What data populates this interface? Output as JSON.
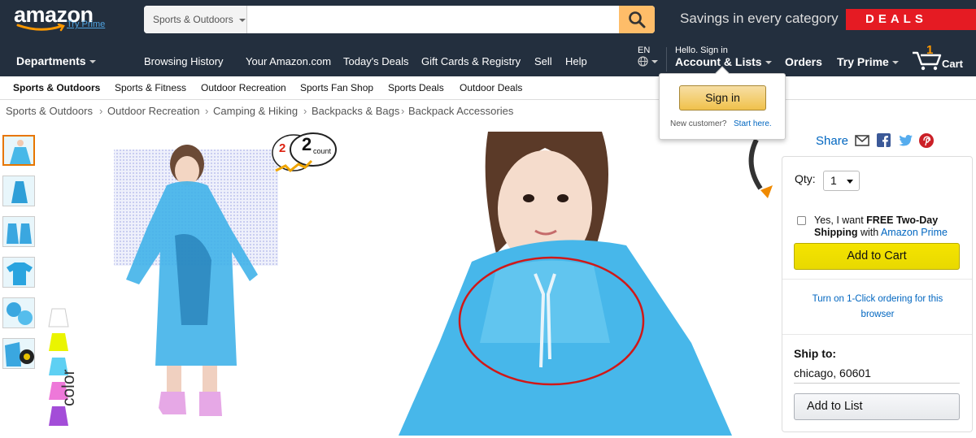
{
  "header": {
    "logo": "amazon",
    "try_prime": "Try Prime",
    "search_category": "Sports & Outdoors",
    "search_placeholder": "",
    "savings_text": "Savings in every category",
    "deals_text": "DEALS"
  },
  "nav": {
    "departments": "Departments",
    "links": [
      "Browsing History",
      "Your Amazon.com",
      "Today's Deals",
      "Gift Cards & Registry",
      "Sell",
      "Help"
    ],
    "language": "EN",
    "hello": "Hello. Sign in",
    "account": "Account & Lists",
    "orders": "Orders",
    "try_prime": "Try Prime",
    "cart_count": "1",
    "cart_label": "Cart"
  },
  "subnav": [
    "Sports & Outdoors",
    "Sports & Fitness",
    "Outdoor Recreation",
    "Sports Fan Shop",
    "Sports Deals",
    "Outdoor Deals"
  ],
  "breadcrumb": [
    "Sports & Outdoors",
    "Outdoor Recreation",
    "Camping & Hiking",
    "Backpacks & Bags",
    "Backpack Accessories"
  ],
  "popover": {
    "sign_in": "Sign in",
    "new_customer": "New customer?",
    "start_here": "Start here."
  },
  "product_image": {
    "count_badge_pack": "2",
    "count_badge_number": "2",
    "count_badge_label": "count",
    "color_label": "color"
  },
  "share": {
    "label": "Share"
  },
  "buybox": {
    "qty_label": "Qty:",
    "qty_value": "1",
    "prime_text_pre": "Yes, I want ",
    "prime_text_bold": "FREE Two-Day Shipping",
    "prime_text_with": " with ",
    "prime_text_link": "Amazon Prime",
    "add_to_cart": "Add to Cart",
    "one_click": "Turn on 1-Click ordering for this browser",
    "ship_to_label": "Ship to:",
    "ship_to_value": "chicago, 60601",
    "add_to_list": "Add to List"
  },
  "colors": {
    "nav_bg": "#232f3e",
    "search_button": "#febd69",
    "deals_red": "#e51b23",
    "link_blue": "#0066c0",
    "raincoat_blue": "#35b4e8"
  }
}
